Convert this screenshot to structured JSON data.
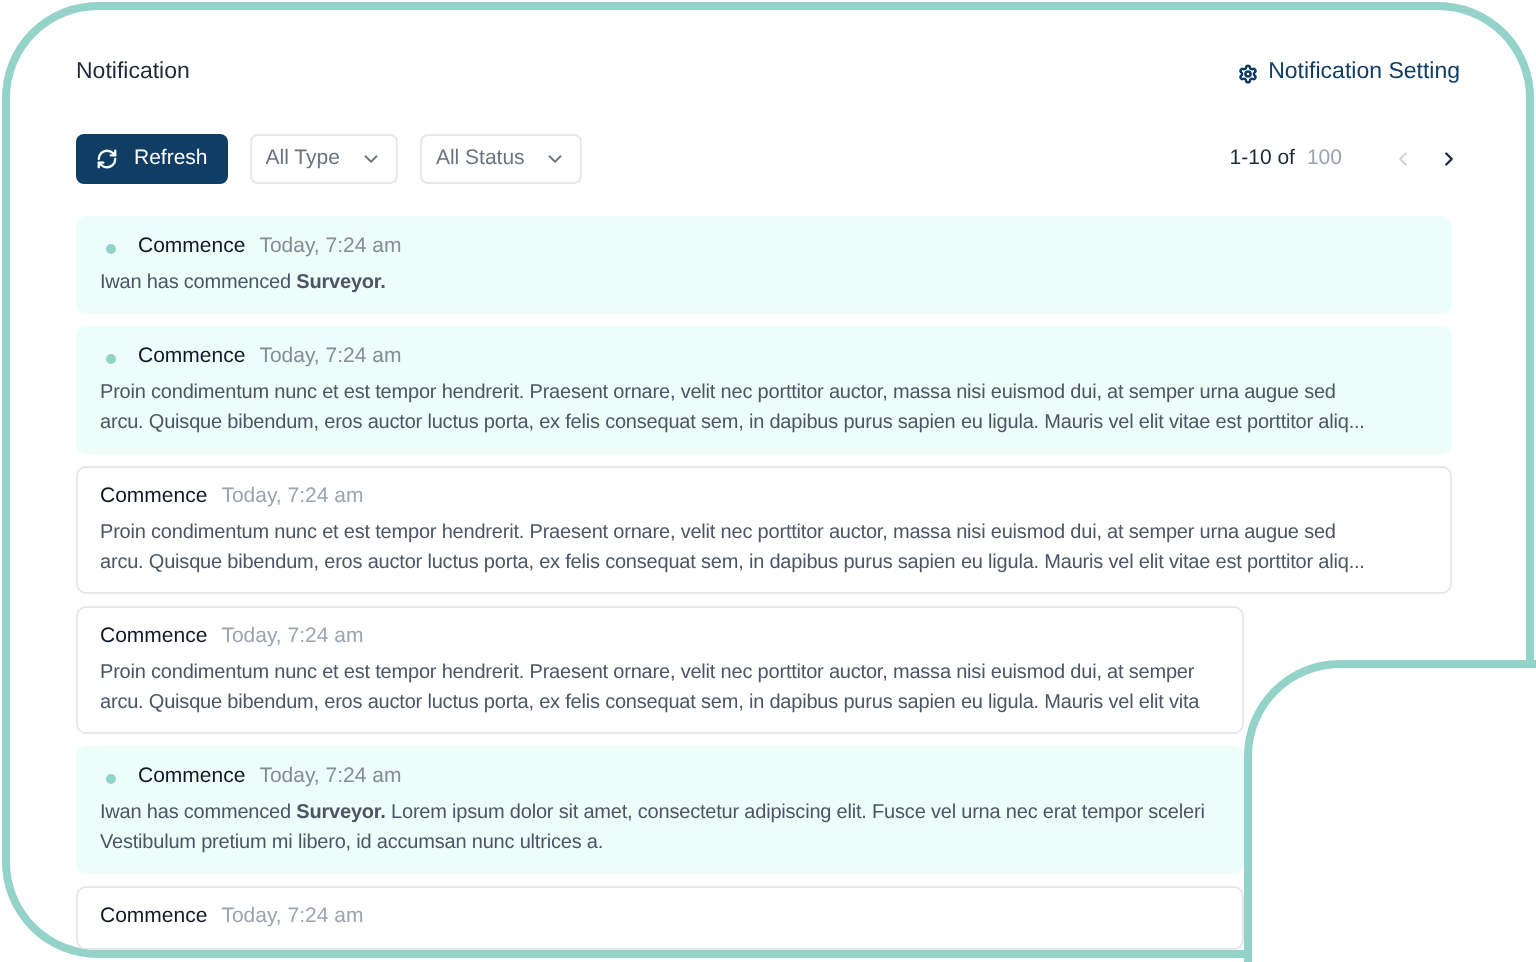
{
  "header": {
    "title": "Notification",
    "settings_link": "Notification Setting"
  },
  "toolbar": {
    "refresh": "Refresh",
    "filters": [
      {
        "label": "All Type"
      },
      {
        "label": "All Status"
      }
    ],
    "range": "1-10 of",
    "total": "100",
    "prev_disabled": true,
    "next_disabled": false
  },
  "notifications": [
    {
      "unread": true,
      "title": "Commence",
      "time": "Today, 7:24 am",
      "lines": [
        "Iwan has commenced **Surveyor.**"
      ]
    },
    {
      "unread": true,
      "title": "Commence",
      "time": "Today, 7:24 am",
      "lines": [
        "Proin condimentum nunc et est tempor hendrerit. Praesent ornare, velit nec porttitor auctor, massa nisi euismod dui, at semper urna augue sed",
        "arcu. Quisque bibendum, eros auctor luctus porta, ex felis consequat sem, in dapibus purus sapien eu ligula. Mauris vel elit vitae est porttitor aliq..."
      ]
    },
    {
      "unread": false,
      "title": "Commence",
      "time": "Today, 7:24 am",
      "lines": [
        "Proin condimentum nunc et est tempor hendrerit. Praesent ornare, velit nec porttitor auctor, massa nisi euismod dui, at semper urna augue sed",
        "arcu. Quisque bibendum, eros auctor luctus porta, ex felis consequat sem, in dapibus purus sapien eu ligula. Mauris vel elit vitae est porttitor aliq..."
      ]
    },
    {
      "unread": false,
      "title": "Commence",
      "time": "Today, 7:24 am",
      "lines": [
        "Proin condimentum nunc et est tempor hendrerit. Praesent ornare, velit nec porttitor auctor, massa nisi euismod dui, at semper",
        "arcu. Quisque bibendum, eros auctor luctus porta, ex felis consequat sem, in dapibus purus sapien eu ligula. Mauris vel elit vita"
      ]
    },
    {
      "unread": true,
      "title": "Commence",
      "time": "Today, 7:24 am",
      "lines": [
        "Iwan has commenced **Surveyor.** Lorem ipsum dolor sit amet, consectetur adipiscing elit. Fusce vel urna nec erat tempor sceleri",
        "Vestibulum pretium mi libero, id accumsan nunc ultrices a."
      ]
    },
    {
      "unread": false,
      "title": "Commence",
      "time": "Today, 7:24 am"
    }
  ]
}
